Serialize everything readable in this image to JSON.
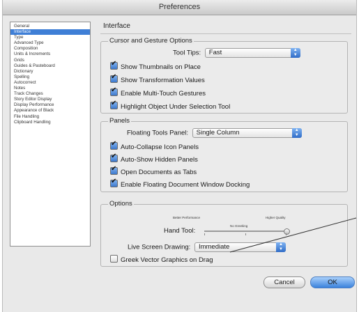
{
  "window": {
    "title": "Preferences"
  },
  "sidebar": {
    "items": [
      "General",
      "Interface",
      "Type",
      "Advanced Type",
      "Composition",
      "Units & Increments",
      "Grids",
      "Guides & Pasteboard",
      "Dictionary",
      "Spelling",
      "Autocorrect",
      "Notes",
      "Track Changes",
      "Story Editor Display",
      "Display Performance",
      "Appearance of Black",
      "File Handling",
      "Clipboard Handling"
    ],
    "selected_index": 1
  },
  "main": {
    "heading": "Interface",
    "cursor_group": {
      "label": "Cursor and Gesture Options",
      "tooltips_label": "Tool Tips:",
      "tooltips_value": "Fast",
      "checks": [
        {
          "label": "Show Thumbnails on Place",
          "checked": true
        },
        {
          "label": "Show Transformation Values",
          "checked": true
        },
        {
          "label": "Enable Multi-Touch Gestures",
          "checked": true
        },
        {
          "label": "Highlight Object Under Selection Tool",
          "checked": true
        }
      ]
    },
    "panels_group": {
      "label": "Panels",
      "floating_label": "Floating Tools Panel:",
      "floating_value": "Single Column",
      "checks": [
        {
          "label": "Auto-Collapse Icon Panels",
          "checked": true
        },
        {
          "label": "Auto-Show Hidden Panels",
          "checked": true
        },
        {
          "label": "Open Documents as Tabs",
          "checked": true
        },
        {
          "label": "Enable Floating Document Window Docking",
          "checked": true
        }
      ]
    },
    "options_group": {
      "label": "Options",
      "better_performance": "Better Performance",
      "higher_quality": "Higher Quality",
      "no_greeking": "No Greeking",
      "hand_tool_label": "Hand Tool:",
      "hand_tool_position": 1.0,
      "live_label": "Live Screen Drawing:",
      "live_value": "Immediate",
      "greek_check": {
        "label": "Greek Vector Graphics on Drag",
        "checked": false
      }
    }
  },
  "buttons": {
    "cancel": "Cancel",
    "ok": "OK"
  },
  "colors": {
    "selection": "#3f7fd6",
    "accent": "#3a82dc"
  }
}
